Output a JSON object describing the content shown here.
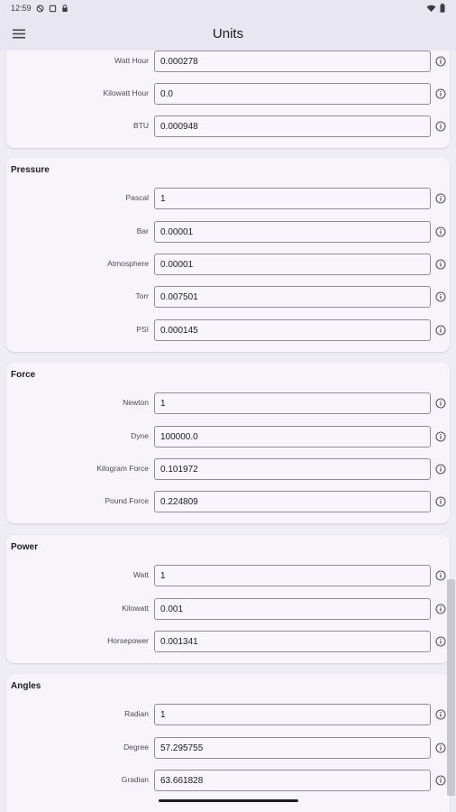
{
  "status_bar": {
    "time": "12:59",
    "icons_left": [
      "do-not-disturb-icon",
      "screenshot-icon",
      "lock-icon"
    ],
    "icons_right": [
      "wifi-icon",
      "battery-icon"
    ]
  },
  "app_bar": {
    "title": "Units",
    "menu_icon": "hamburger-menu-icon"
  },
  "sections": [
    {
      "title": "",
      "rows": [
        {
          "label": "Watt Hour",
          "value": "0.000278"
        },
        {
          "label": "Kilowatt Hour",
          "value": "0.0"
        },
        {
          "label": "BTU",
          "value": "0.000948"
        }
      ]
    },
    {
      "title": "Pressure",
      "rows": [
        {
          "label": "Pascal",
          "value": "1"
        },
        {
          "label": "Bar",
          "value": "0.00001"
        },
        {
          "label": "Atmosphere",
          "value": "0.00001"
        },
        {
          "label": "Torr",
          "value": "0.007501"
        },
        {
          "label": "PSI",
          "value": "0.000145"
        }
      ]
    },
    {
      "title": "Force",
      "rows": [
        {
          "label": "Newton",
          "value": "1"
        },
        {
          "label": "Dyne",
          "value": "100000.0"
        },
        {
          "label": "Kilogram Force",
          "value": "0.101972"
        },
        {
          "label": "Pound Force",
          "value": "0.224809"
        }
      ]
    },
    {
      "title": "Power",
      "rows": [
        {
          "label": "Watt",
          "value": "1"
        },
        {
          "label": "Kilowatt",
          "value": "0.001"
        },
        {
          "label": "Horsepower",
          "value": "0.001341"
        }
      ]
    },
    {
      "title": "Angles",
      "rows": [
        {
          "label": "Radian",
          "value": "1"
        },
        {
          "label": "Degree",
          "value": "57.295755"
        },
        {
          "label": "Gradian",
          "value": "63.661828"
        }
      ]
    }
  ]
}
